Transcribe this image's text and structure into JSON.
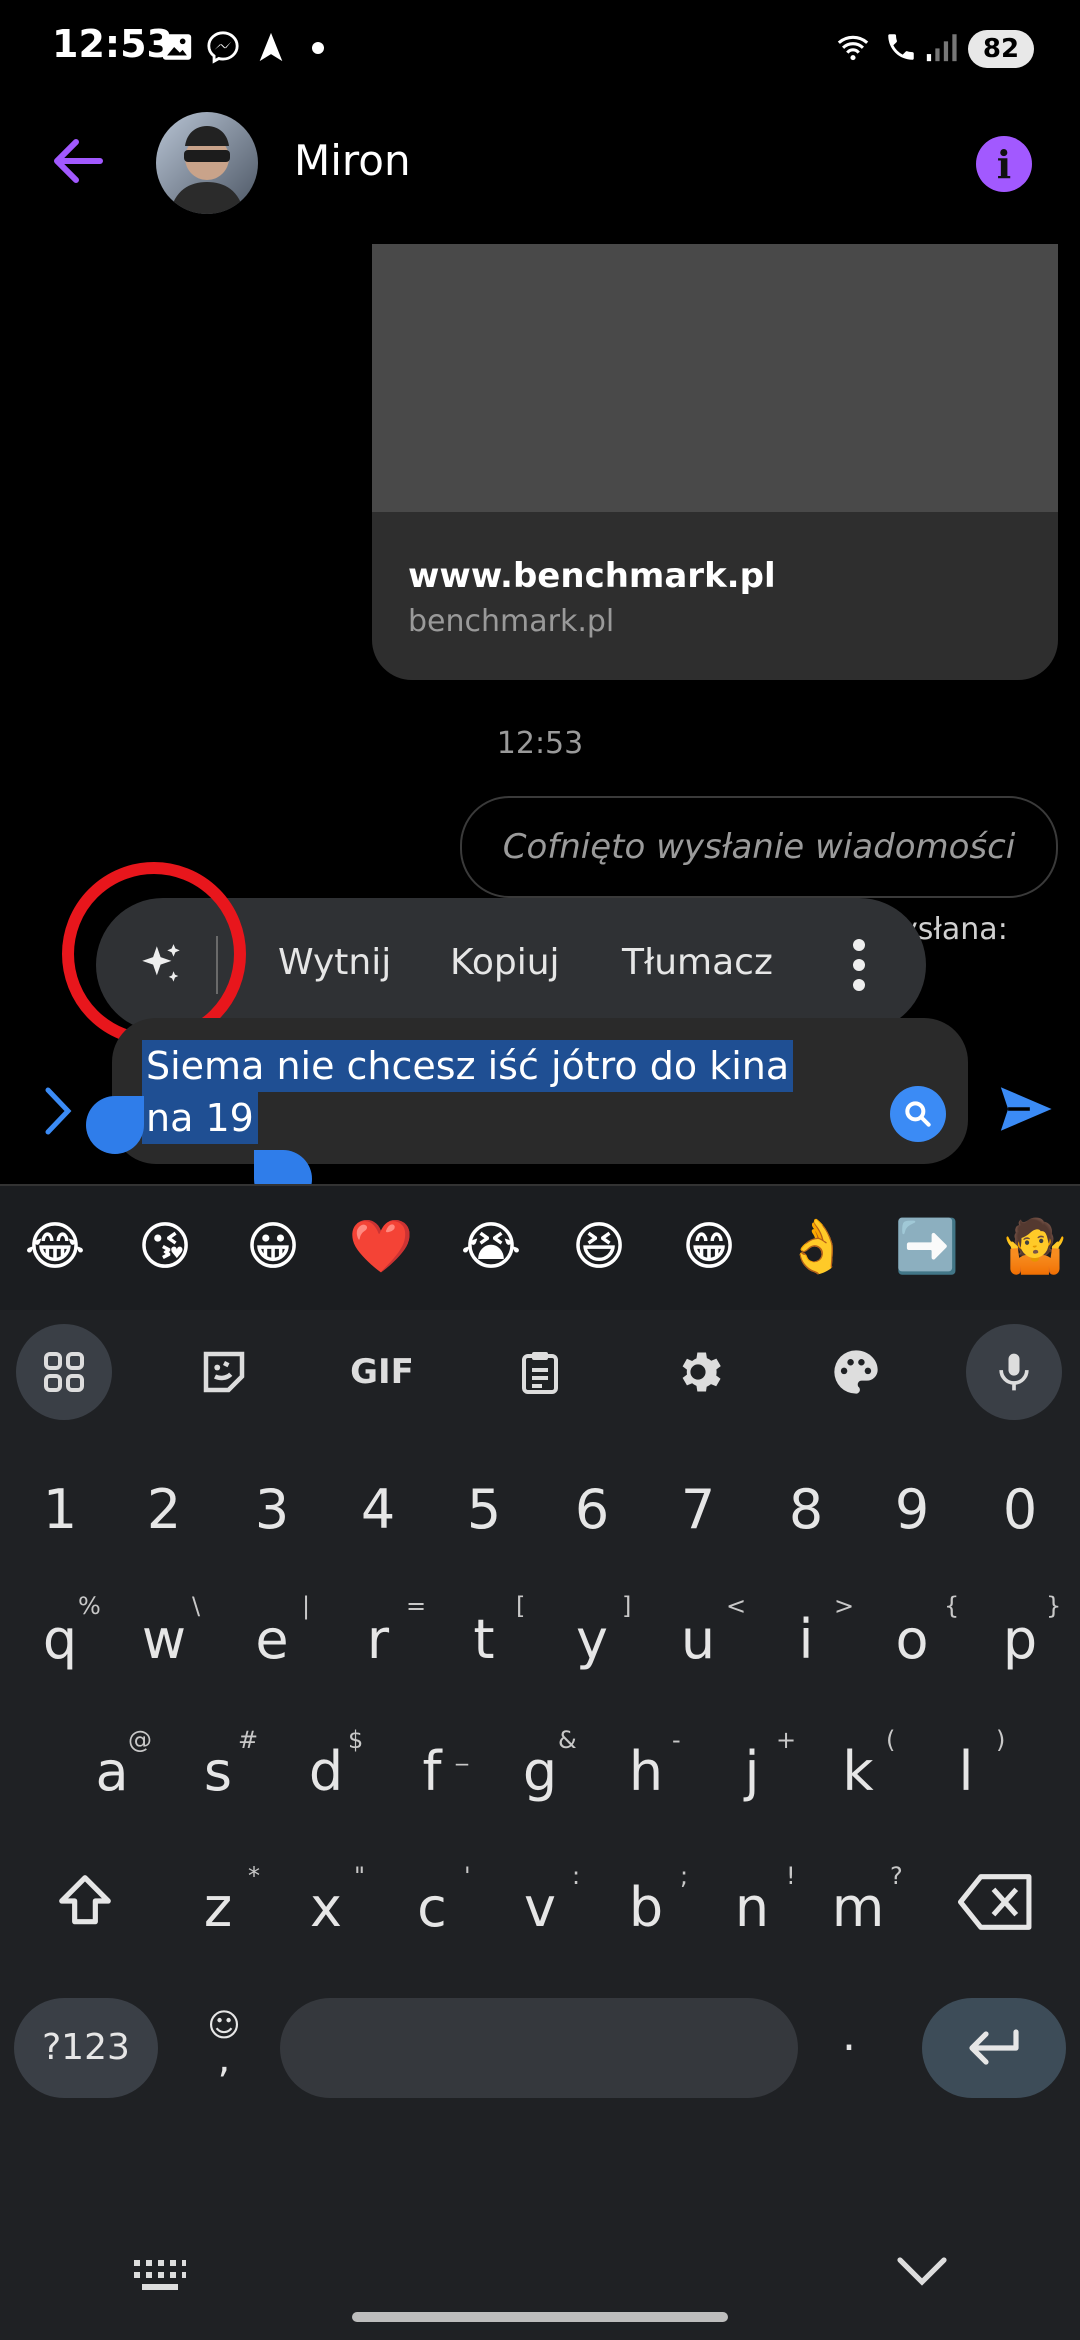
{
  "status_bar": {
    "time": "12:53",
    "battery": "82",
    "icons": [
      "gallery-icon",
      "messenger-icon",
      "navigation-icon",
      "dot-icon",
      "wifi-calling-icon",
      "call-icon",
      "signal-icon"
    ]
  },
  "header": {
    "contact_name": "Miron",
    "info_label": "i",
    "accent_color": "#a259ff"
  },
  "link_preview": {
    "title": "www.benchmark.pl",
    "domain": "benchmark.pl"
  },
  "timestamp": "12:53",
  "unsent_message": "Cofnięto wysłanie wiadomości",
  "partially_hidden_text": "ysłana:",
  "selection_toolbar": {
    "cut": "Wytnij",
    "copy": "Kopiuj",
    "translate": "Tłumacz"
  },
  "composer": {
    "line1": "Siema nie chcesz iść jótro do kina",
    "line2": "na 19"
  },
  "emoji_row": [
    "😂",
    "😘",
    "😀",
    "❤️",
    "😭",
    "😆",
    "😁",
    "👌",
    "➡️",
    "🤷"
  ],
  "keyboard": {
    "gif_label": "GIF",
    "numbers": [
      "1",
      "2",
      "3",
      "4",
      "5",
      "6",
      "7",
      "8",
      "9",
      "0"
    ],
    "row1": [
      "q",
      "w",
      "e",
      "r",
      "t",
      "y",
      "u",
      "i",
      "o",
      "p"
    ],
    "row1_hints": [
      "%",
      "\\",
      "|",
      "=",
      "[",
      "]",
      "<",
      ">",
      "{",
      "}"
    ],
    "row2": [
      "a",
      "s",
      "d",
      "f",
      "g",
      "h",
      "j",
      "k",
      "l"
    ],
    "row2_hints": [
      "@",
      "#",
      "$",
      "_",
      "&",
      "-",
      "+",
      "(",
      ")"
    ],
    "row3": [
      "z",
      "x",
      "c",
      "v",
      "b",
      "n",
      "m"
    ],
    "row3_hints": [
      "*",
      "\"",
      "'",
      ":",
      ";",
      "!",
      "?"
    ],
    "symbols_label": "?123",
    "emoji_key": "☺",
    "comma": ",",
    "period": "."
  }
}
